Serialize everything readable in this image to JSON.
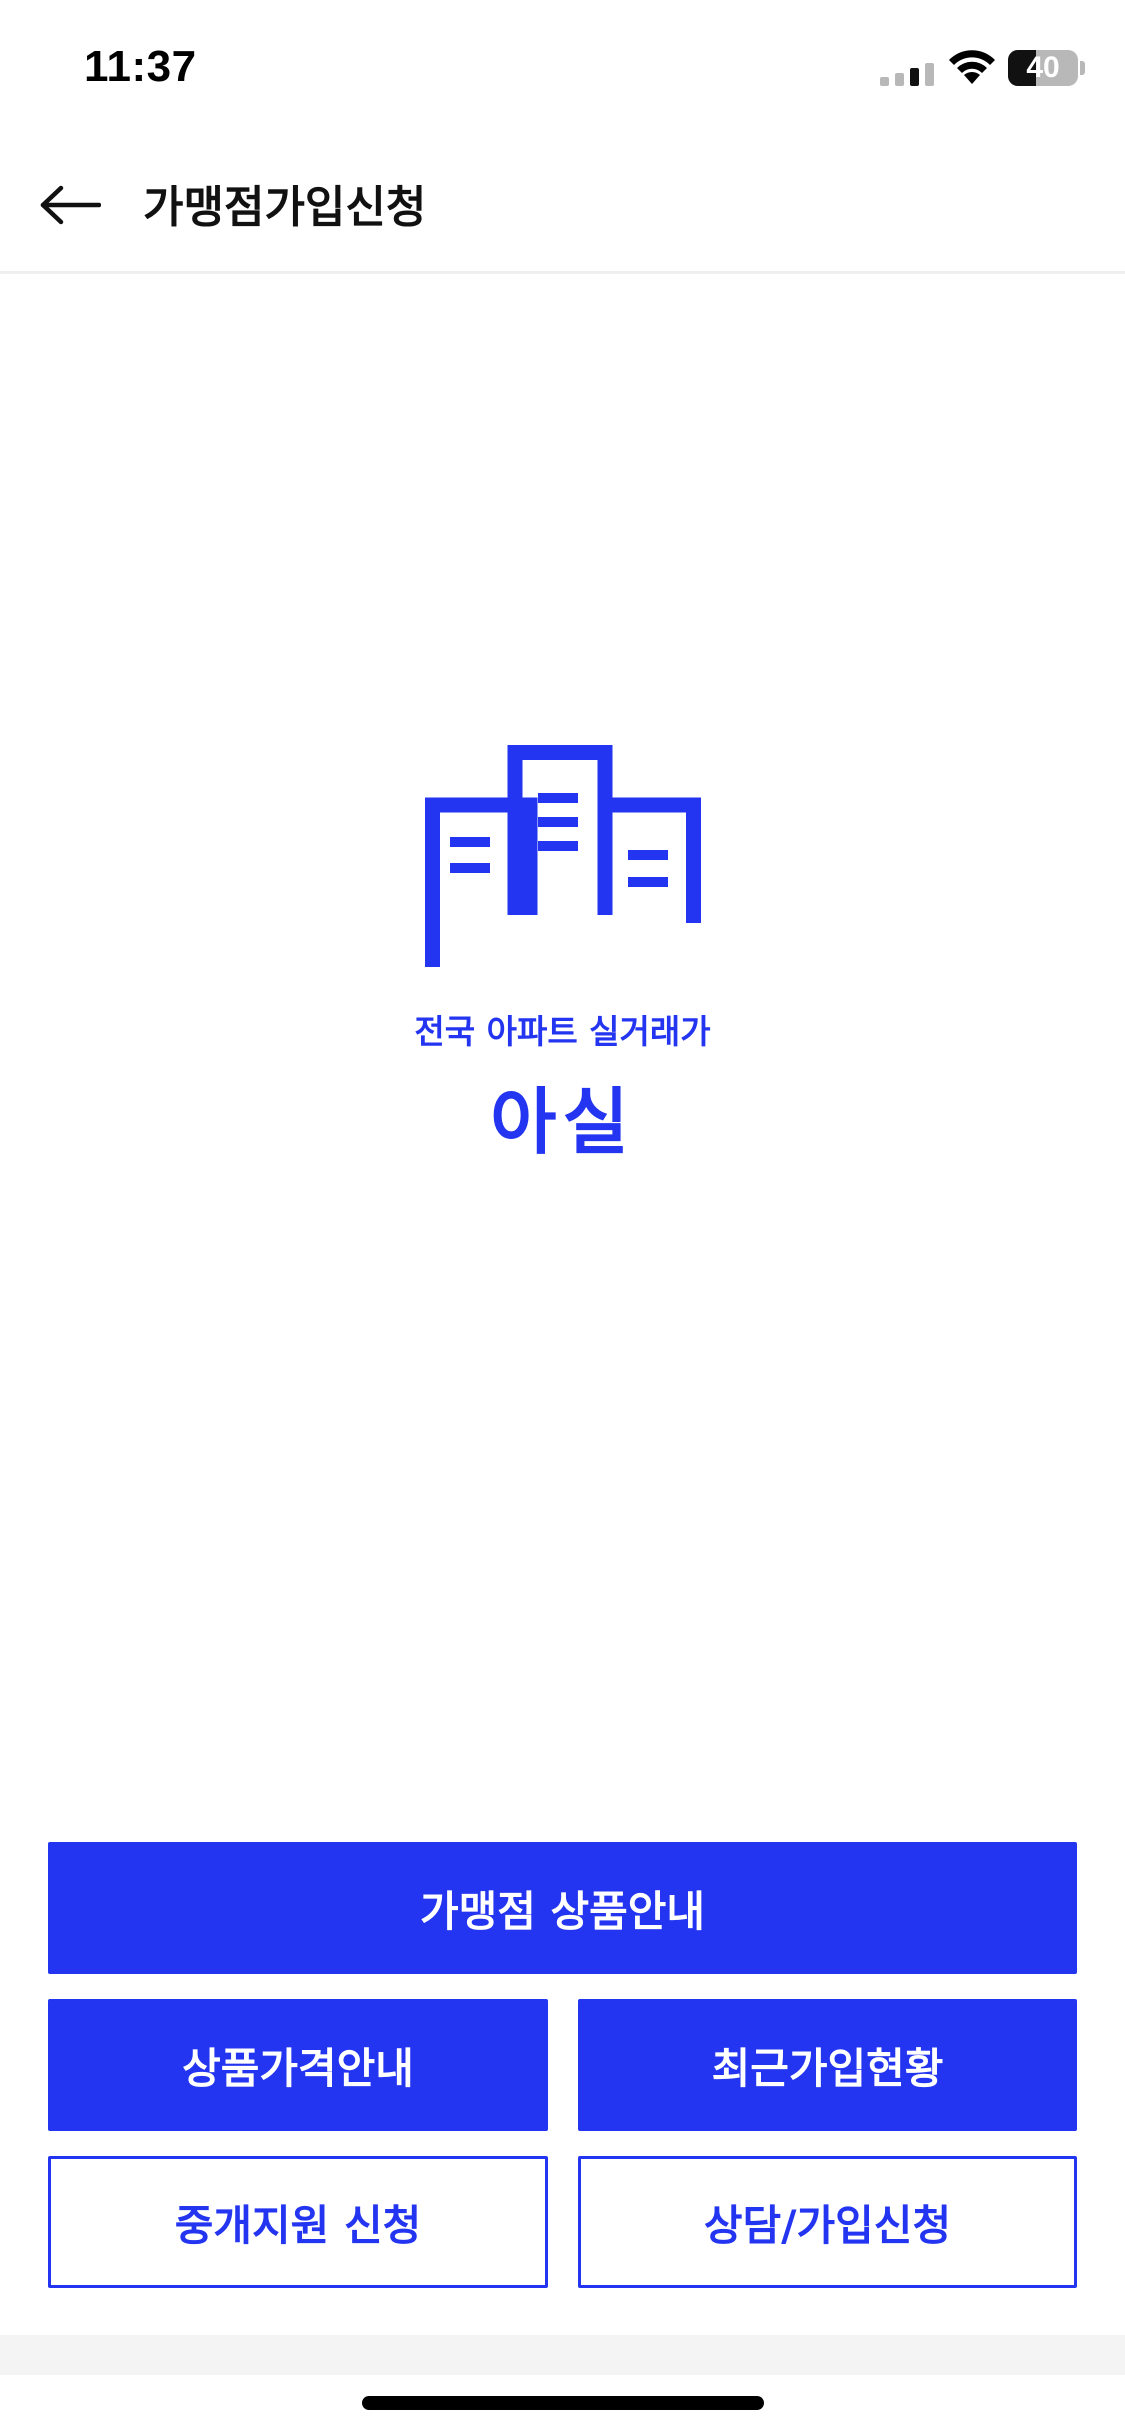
{
  "status_bar": {
    "time": "11:37",
    "battery_level": "40",
    "battery_fraction": 0.4,
    "icons": [
      "signal-icon",
      "wifi-icon",
      "battery-icon"
    ]
  },
  "header": {
    "title": "가맹점가입신청",
    "back_icon": "arrow-left-icon"
  },
  "logo": {
    "tagline": "전국 아파트 실거래가",
    "name": "아실",
    "icon": "apartment-buildings-icon",
    "color": "#2335f0"
  },
  "buttons": {
    "franchise_info": "가맹점 상품안내",
    "price_info": "상품가격안내",
    "recent_signups": "최근가입현황",
    "brokerage_support": "중개지원 신청",
    "consult_signup": "상담/가입신청"
  },
  "colors": {
    "accent": "#2335f0",
    "text_dark": "#111111",
    "divider": "#efefef"
  }
}
